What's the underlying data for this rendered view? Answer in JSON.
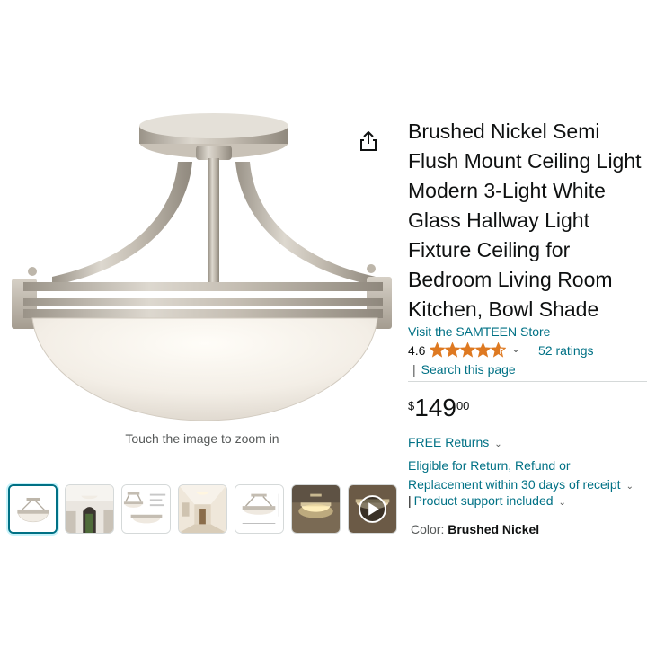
{
  "product": {
    "title": "Brushed Nickel Semi Flush Mount Ceiling Light Modern 3-Light White Glass Hallway Light Fixture Ceiling for Bedroom Living Room Kitchen, Bowl Shade",
    "store_link": "Visit the SAMTEEN Store",
    "rating": "4.6",
    "rating_fraction": 0.92,
    "ratings_count": "52 ratings",
    "search_link": "Search this page",
    "price": {
      "symbol": "$",
      "whole": "149",
      "fraction": "00"
    },
    "returns": "FREE Returns",
    "eligibility_line1": "Eligible for Return, Refund or",
    "eligibility_line2": "Replacement within 30 days of receipt",
    "support": "Product support included",
    "color_label": "Color:",
    "color_value": "Brushed Nickel"
  },
  "gallery": {
    "zoom_hint": "Touch the image to zoom in",
    "thumbnails": [
      "main-fixture",
      "room-install",
      "dimensions",
      "hallway",
      "size-chart",
      "lit-fixture",
      "video"
    ],
    "selected_index": 0
  },
  "icons": {
    "share": "share-icon",
    "play": "play-icon",
    "star": "star-icon",
    "chevron": "chevron-down-icon"
  },
  "colors": {
    "link": "#007185",
    "star": "#de7921",
    "selected_border": "#007185"
  }
}
